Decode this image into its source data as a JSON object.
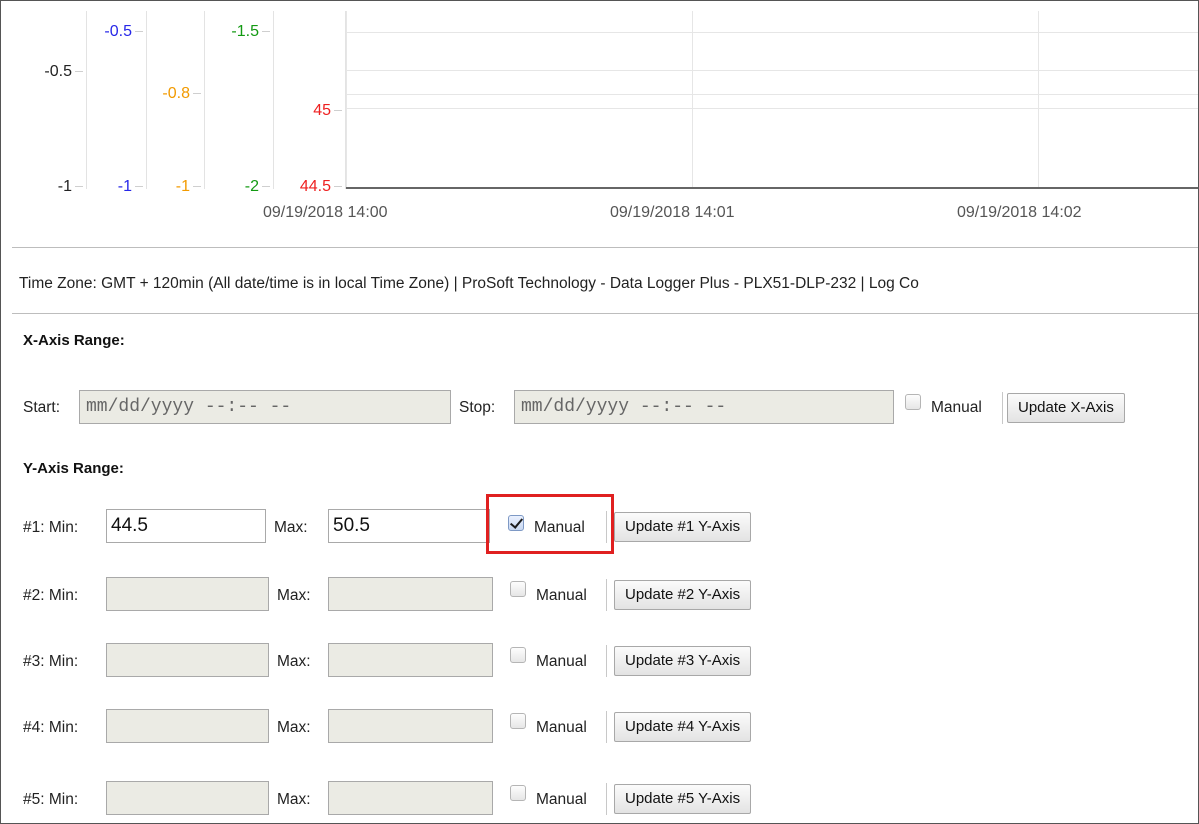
{
  "chart": {
    "axes": [
      {
        "color": "#222222",
        "ticks": [
          "-0.5",
          "-1"
        ]
      },
      {
        "color": "#2727e8",
        "ticks": [
          "-0.5",
          "-1"
        ]
      },
      {
        "color": "#f29a00",
        "ticks": [
          "-0.8",
          "-1"
        ]
      },
      {
        "color": "#139a13",
        "ticks": [
          "-1.5",
          "-2"
        ]
      },
      {
        "color": "#ee2020",
        "ticks": [
          "45",
          "44.5"
        ]
      }
    ],
    "x_ticks": [
      "09/19/2018 14:00",
      "09/19/2018 14:01",
      "09/19/2018 14:02"
    ]
  },
  "footer": {
    "text": "Time Zone: GMT + 120min (All date/time is in local Time Zone) | ProSoft Technology - Data Logger Plus - PLX51-DLP-232 | Log Co"
  },
  "x_axis": {
    "title": "X-Axis Range:",
    "start_label": "Start:",
    "start_placeholder": "mm/dd/yyyy --:-- --",
    "stop_label": "Stop:",
    "stop_placeholder": "mm/dd/yyyy --:-- --",
    "manual_label": "Manual",
    "manual_checked": false,
    "update_label": "Update X-Axis"
  },
  "y_axis": {
    "title": "Y-Axis Range:",
    "rows": [
      {
        "label": "#1: Min:",
        "min": "44.5",
        "max_label": "Max:",
        "max": "50.5",
        "manual_label": "Manual",
        "manual_checked": true,
        "update_label": "Update #1 Y-Axis"
      },
      {
        "label": "#2: Min:",
        "min": "",
        "max_label": "Max:",
        "max": "",
        "manual_label": "Manual",
        "manual_checked": false,
        "update_label": "Update #2 Y-Axis"
      },
      {
        "label": "#3: Min:",
        "min": "",
        "max_label": "Max:",
        "max": "",
        "manual_label": "Manual",
        "manual_checked": false,
        "update_label": "Update #3 Y-Axis"
      },
      {
        "label": "#4: Min:",
        "min": "",
        "max_label": "Max:",
        "max": "",
        "manual_label": "Manual",
        "manual_checked": false,
        "update_label": "Update #4 Y-Axis"
      },
      {
        "label": "#5: Min:",
        "min": "",
        "max_label": "Max:",
        "max": "",
        "manual_label": "Manual",
        "manual_checked": false,
        "update_label": "Update #5 Y-Axis"
      }
    ]
  },
  "annotation": {
    "highlight_color": "#e02020"
  }
}
